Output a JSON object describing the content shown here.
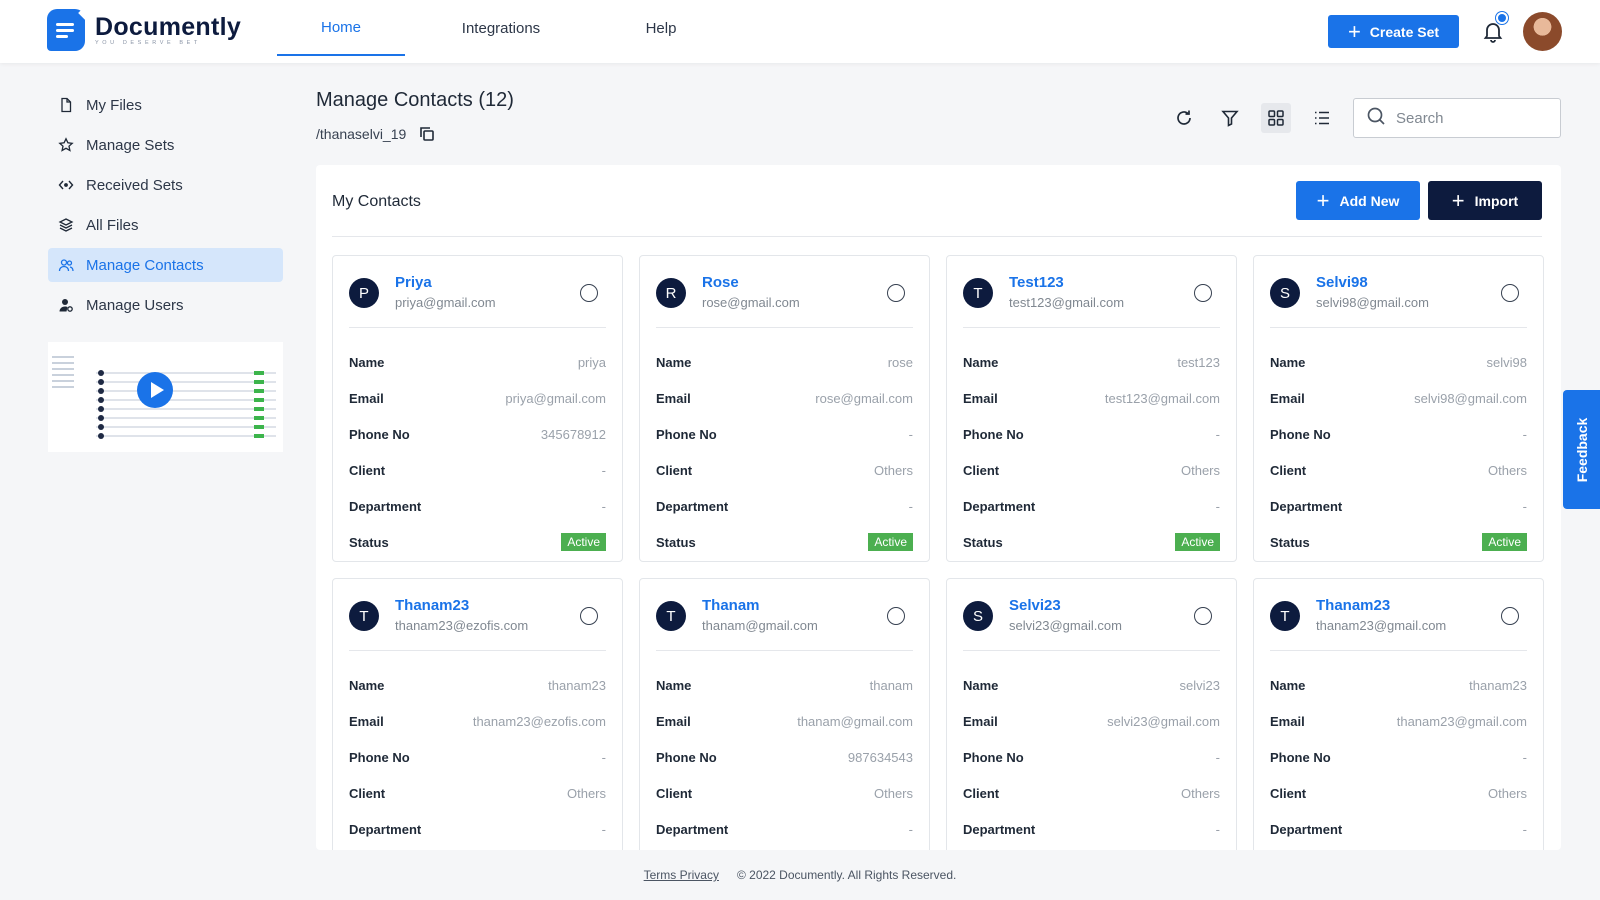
{
  "app": {
    "name": "Documently",
    "tagline": "YOU DESERVE BET"
  },
  "nav": {
    "tabs": [
      {
        "label": "Home",
        "active": true
      },
      {
        "label": "Integrations",
        "active": false
      },
      {
        "label": "Help",
        "active": false
      }
    ],
    "create_label": "Create Set"
  },
  "sidebar": {
    "items": [
      {
        "label": "My Files",
        "icon": "file-icon"
      },
      {
        "label": "Manage Sets",
        "icon": "star-icon"
      },
      {
        "label": "Received Sets",
        "icon": "share-icon"
      },
      {
        "label": "All Files",
        "icon": "layers-icon"
      },
      {
        "label": "Manage Contacts",
        "icon": "contacts-icon",
        "active": true
      },
      {
        "label": "Manage Users",
        "icon": "user-gear-icon"
      }
    ]
  },
  "page": {
    "title": "Manage Contacts (12)",
    "path": "/thanaselvi_19",
    "search_placeholder": "Search"
  },
  "contacts_panel": {
    "title": "My Contacts",
    "add_label": "Add New",
    "import_label": "Import",
    "field_labels": {
      "name": "Name",
      "email": "Email",
      "phone": "Phone No",
      "client": "Client",
      "department": "Department",
      "status": "Status"
    },
    "cards": [
      {
        "initial": "P",
        "display": "Priya",
        "email": "priya@gmail.com",
        "name": "priya",
        "phone": "345678912",
        "client": "-",
        "department": "-",
        "status": "Active"
      },
      {
        "initial": "R",
        "display": "Rose",
        "email": "rose@gmail.com",
        "name": "rose",
        "phone": "-",
        "client": "Others",
        "department": "-",
        "status": "Active"
      },
      {
        "initial": "T",
        "display": "Test123",
        "email": "test123@gmail.com",
        "name": "test123",
        "phone": "-",
        "client": "Others",
        "department": "-",
        "status": "Active"
      },
      {
        "initial": "S",
        "display": "Selvi98",
        "email": "selvi98@gmail.com",
        "name": "selvi98",
        "phone": "-",
        "client": "Others",
        "department": "-",
        "status": "Active"
      },
      {
        "initial": "T",
        "display": "Thanam23",
        "email": "thanam23@ezofis.com",
        "name": "thanam23",
        "phone": "-",
        "client": "Others",
        "department": "-",
        "status": ""
      },
      {
        "initial": "T",
        "display": "Thanam",
        "email": "thanam@gmail.com",
        "name": "thanam",
        "phone": "987634543",
        "client": "Others",
        "department": "-",
        "status": ""
      },
      {
        "initial": "S",
        "display": "Selvi23",
        "email": "selvi23@gmail.com",
        "name": "selvi23",
        "phone": "-",
        "client": "Others",
        "department": "-",
        "status": ""
      },
      {
        "initial": "T",
        "display": "Thanam23",
        "email": "thanam23@gmail.com",
        "name": "thanam23",
        "phone": "-",
        "client": "Others",
        "department": "-",
        "status": ""
      }
    ]
  },
  "feedback_label": "Feedback",
  "footer": {
    "links": "Terms Privacy",
    "copyright": "© 2022 Documently. All Rights Reserved."
  },
  "colors": {
    "accent": "#1a73e8",
    "navy": "#0d1b3e",
    "active_status": "#4caf50"
  }
}
